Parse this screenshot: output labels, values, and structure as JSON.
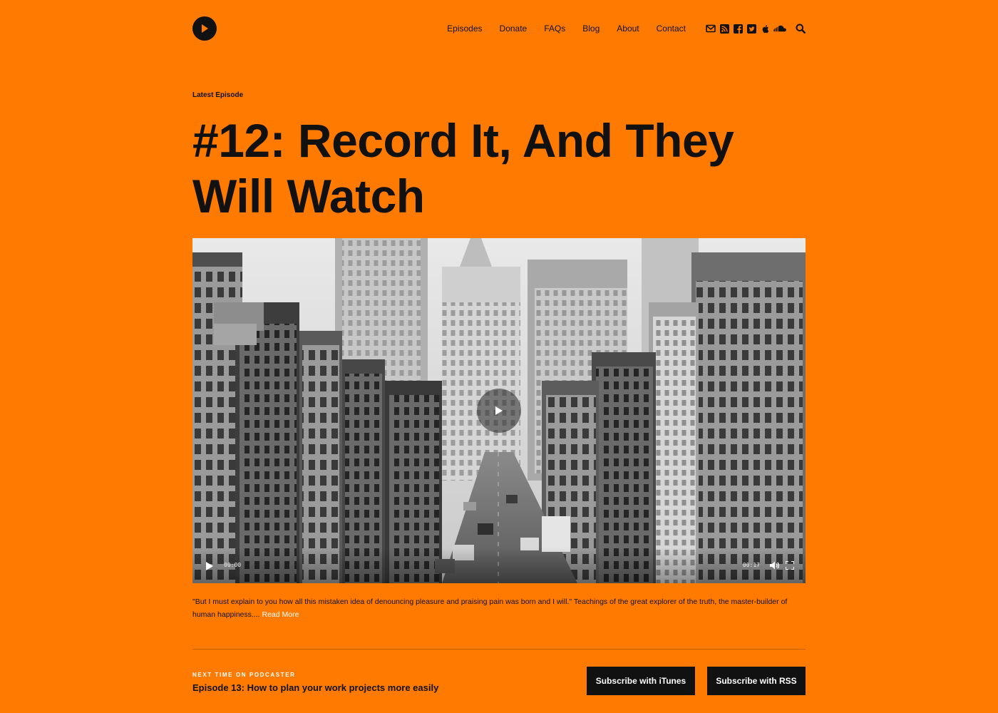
{
  "nav": {
    "items": [
      {
        "label": "Episodes"
      },
      {
        "label": "Donate"
      },
      {
        "label": "FAQs"
      },
      {
        "label": "Blog"
      },
      {
        "label": "About"
      },
      {
        "label": "Contact"
      }
    ],
    "social_icons": [
      "envelope-icon",
      "rss-icon",
      "facebook-icon",
      "twitter-icon",
      "apple-icon",
      "soundcloud-icon"
    ],
    "search_icon": "search-icon"
  },
  "logo_icon": "play-circle-icon",
  "hero": {
    "kicker": "Latest Episode",
    "title": "#12: Record It, And They Will Watch"
  },
  "player": {
    "current_time": "00:00",
    "duration": "00:17",
    "image_description_icon": "black-and-white-city-street-photo"
  },
  "excerpt": {
    "text": "\"But I must explain to you how all this mistaken idea of denouncing pleasure and praising pain was born and I will.\" Teachings of the great explorer of the truth, the master-builder of human happiness....",
    "read_more": "Read More"
  },
  "next": {
    "label": "NEXT TIME ON PODCASTER",
    "title": "Episode 13: How to plan your work projects more easily"
  },
  "buttons": {
    "itunes": "Subscribe with iTunes",
    "rss": "Subscribe with RSS"
  },
  "colors": {
    "background": "#ff7a00",
    "text": "#111111",
    "accent_link": "#ffffff",
    "button_bg": "#111111"
  }
}
